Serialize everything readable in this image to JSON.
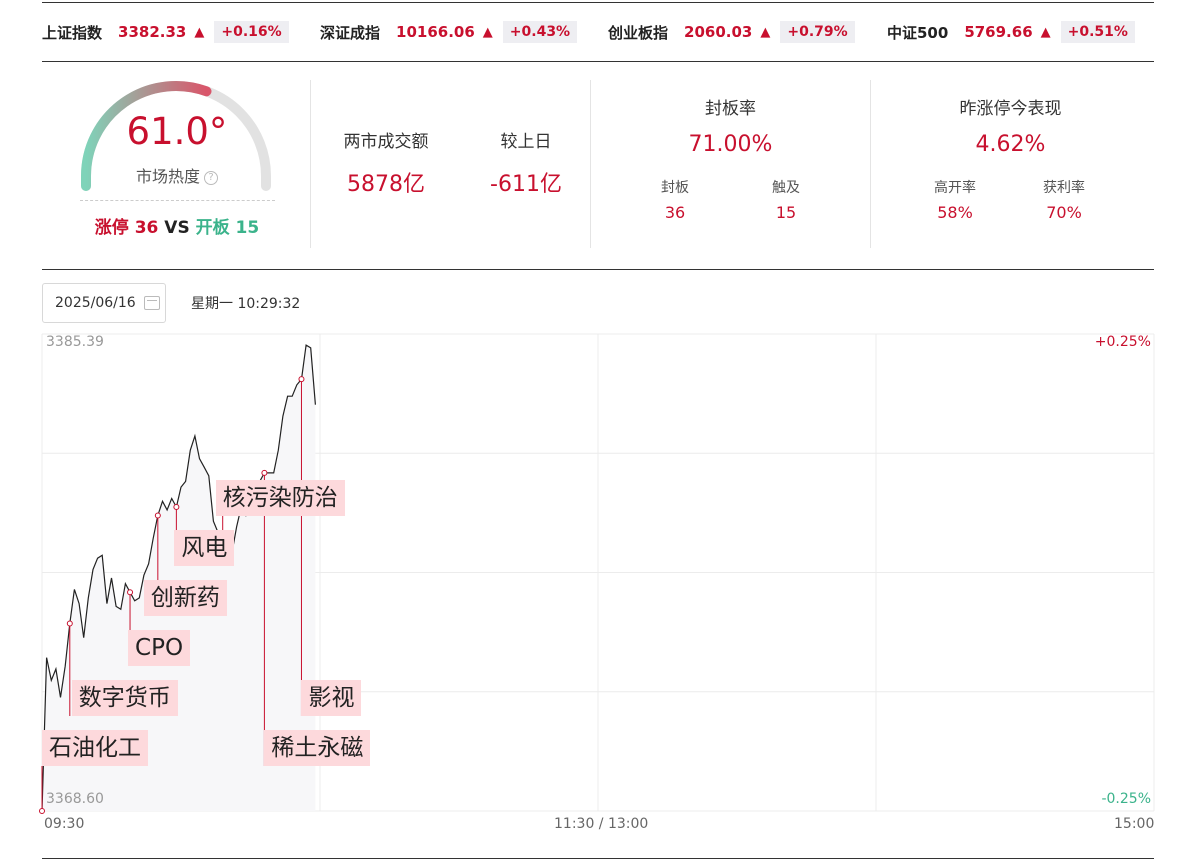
{
  "indices": [
    {
      "name": "上证指数",
      "value": "3382.33",
      "arrow": "▲",
      "change": "+0.16%"
    },
    {
      "name": "深证成指",
      "value": "10166.06",
      "arrow": "▲",
      "change": "+0.43%"
    },
    {
      "name": "创业板指",
      "value": "2060.03",
      "arrow": "▲",
      "change": "+0.79%"
    },
    {
      "name": "中证500",
      "value": "5769.66",
      "arrow": "▲",
      "change": "+0.51%"
    }
  ],
  "heat": {
    "value": "61.0°",
    "label": "市场热度",
    "help": "?",
    "limit_up_label": "涨停",
    "limit_up_count": "36",
    "vs": "VS",
    "open_label": "开板",
    "open_count": "15",
    "gauge_fraction": 0.61
  },
  "turnover": {
    "label": "两市成交额",
    "value": "5878亿",
    "compare_label": "较上日",
    "compare_value": "-611亿"
  },
  "seal_rate": {
    "title": "封板率",
    "value": "71.00%",
    "sealed_label": "封板",
    "sealed_value": "36",
    "touched_label": "触及",
    "touched_value": "15"
  },
  "yesterday": {
    "title": "昨涨停今表现",
    "value": "4.62%",
    "high_open_label": "高开率",
    "high_open_value": "58%",
    "profit_label": "获利率",
    "profit_value": "70%"
  },
  "toolbar": {
    "date": "2025/06/16",
    "weekday_time": "星期一 10:29:32"
  },
  "colors": {
    "up": "#c8102e",
    "down": "#3bb38b",
    "tag_bg": "#fdd9dc"
  },
  "chart_data": {
    "type": "line",
    "y_top_label": "3385.39",
    "y_bottom_label": "3368.60",
    "y_top_pct": "+0.25%",
    "y_bottom_pct": "-0.25%",
    "ylim": [
      3368.6,
      3385.39
    ],
    "x_labels": [
      "09:30",
      "11:30 / 13:00",
      "15:00"
    ],
    "x_minutes_total": 240,
    "grid": true,
    "x": [
      0,
      1,
      2,
      3,
      4,
      5,
      6,
      7,
      8,
      9,
      10,
      11,
      12,
      13,
      14,
      15,
      16,
      17,
      18,
      19,
      20,
      21,
      22,
      23,
      24,
      25,
      26,
      27,
      28,
      29,
      30,
      31,
      32,
      33,
      34,
      35,
      36,
      37,
      38,
      39,
      40,
      41,
      42,
      43,
      44,
      45,
      46,
      47,
      48,
      49,
      50,
      51,
      52,
      53,
      54,
      55,
      56,
      57,
      58,
      59
    ],
    "y": [
      3368.6,
      3374.0,
      3373.2,
      3373.6,
      3372.6,
      3373.7,
      3375.2,
      3376.4,
      3375.9,
      3374.7,
      3376.1,
      3377.1,
      3377.5,
      3377.6,
      3375.9,
      3376.8,
      3375.8,
      3375.7,
      3376.6,
      3376.3,
      3376.0,
      3376.1,
      3376.9,
      3377.3,
      3378.2,
      3379.0,
      3379.5,
      3379.2,
      3379.6,
      3379.3,
      3380.0,
      3380.2,
      3381.3,
      3381.8,
      3381.0,
      3380.7,
      3380.4,
      3378.8,
      3378.4,
      3378.0,
      3378.0,
      3377.7,
      3378.6,
      3379.3,
      3379.0,
      3379.4,
      3379.7,
      3380.2,
      3380.5,
      3380.5,
      3380.5,
      3381.3,
      3382.5,
      3383.2,
      3383.2,
      3383.6,
      3383.8,
      3385.0,
      3384.9,
      3382.9
    ],
    "annotations": [
      {
        "label": "石油化工",
        "x": 0
      },
      {
        "label": "数字货币",
        "x": 6
      },
      {
        "label": "CPO",
        "x": 19
      },
      {
        "label": "创新药",
        "x": 25
      },
      {
        "label": "风电",
        "x": 29
      },
      {
        "label": "核污染防治",
        "x": 39
      },
      {
        "label": "稀土永磁",
        "x": 48
      },
      {
        "label": "影视",
        "x": 56
      }
    ]
  }
}
